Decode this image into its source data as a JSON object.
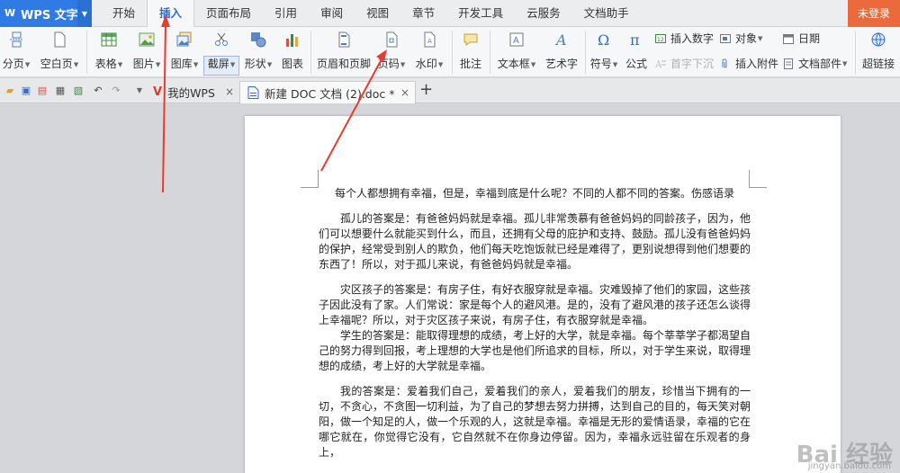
{
  "app": {
    "name": "WPS 文字",
    "login": "未登录"
  },
  "menu": {
    "tabs": [
      "开始",
      "插入",
      "页面布局",
      "引用",
      "审阅",
      "视图",
      "章节",
      "开发工具",
      "云服务",
      "文档助手"
    ],
    "active": "插入"
  },
  "ribbon": {
    "page_break": "分页",
    "blank_page": "空白页",
    "table": "表格",
    "picture": "图片",
    "gallery": "图库",
    "screenshot": "截屏",
    "shape": "形状",
    "chart": "图表",
    "header_footer": "页眉和页脚",
    "page_number": "页码",
    "watermark": "水印",
    "comment": "批注",
    "textbox": "文本框",
    "wordart": "艺术字",
    "symbol": "符号",
    "formula": "公式",
    "insert_number": "插入数字",
    "object": "对象",
    "date": "日期",
    "drop_cap": "首字下沉",
    "attachment": "插入附件",
    "doc_parts": "文档部件",
    "hyperlink": "超链接"
  },
  "doc_tabs": {
    "tab1": "我的WPS",
    "tab2": "新建 DOC 文档 (2).doc *"
  },
  "document": {
    "title": "每个人都想拥有幸福，但是，幸福到底是什么呢？不同的人都不同的答案。伤感语录",
    "p1": "孤儿的答案是：有爸爸妈妈就是幸福。孤儿非常羡慕有爸爸妈妈的同龄孩子，因为，他们可以想要什么就能买到什么，而且，还拥有父母的庇护和支持、鼓励。孤儿没有爸爸妈妈的保护，经常受到别人的欺负，他们每天吃饱饭就已经是难得了，更别说想得到他们想要的东西了！所以，对于孤儿来说，有爸爸妈妈就是幸福。",
    "p2": "灾区孩子的答案是：有房子住，有好衣服穿就是幸福。灾难毁掉了他们的家园，这些孩子因此没有了家。人们常说：家是每个人的避风港。是的，没有了避风港的孩子还怎么谈得上幸福呢？所以，对于灾区孩子来说，有房子住，有衣服穿就是幸福。",
    "p3": "学生的答案是：能取得理想的成绩，考上好的大学，就是幸福。每个莘莘学子都渴望自己的努力得到回报，考上理想的大学也是他们所追求的目标，所以，对于学生来说，取得理想的成绩，考上好的大学就是幸福。",
    "p4": "我的答案是：爱着我们自己，爱着我们的亲人，爱着我们的朋友，珍惜当下拥有的一切，不贪心，不贪图一切利益，为了自己的梦想去努力拼搏，达到自己的目的，每天笑对朝阳，做一个知足的人，做一个乐观的人，这就是幸福。幸福是无形的爱情语录，幸福的它在哪它就在，你觉得它没有，它自然就不在你身边停留。因为，幸福永远驻留在乐观者的身上，"
  },
  "watermark": {
    "brand": "Bai 经验",
    "url": "jingyan.baidu.com"
  },
  "colors": {
    "accent": "#2f7ae5",
    "login_bg": "#ea6a3b",
    "arrow": "#e83a2f"
  }
}
